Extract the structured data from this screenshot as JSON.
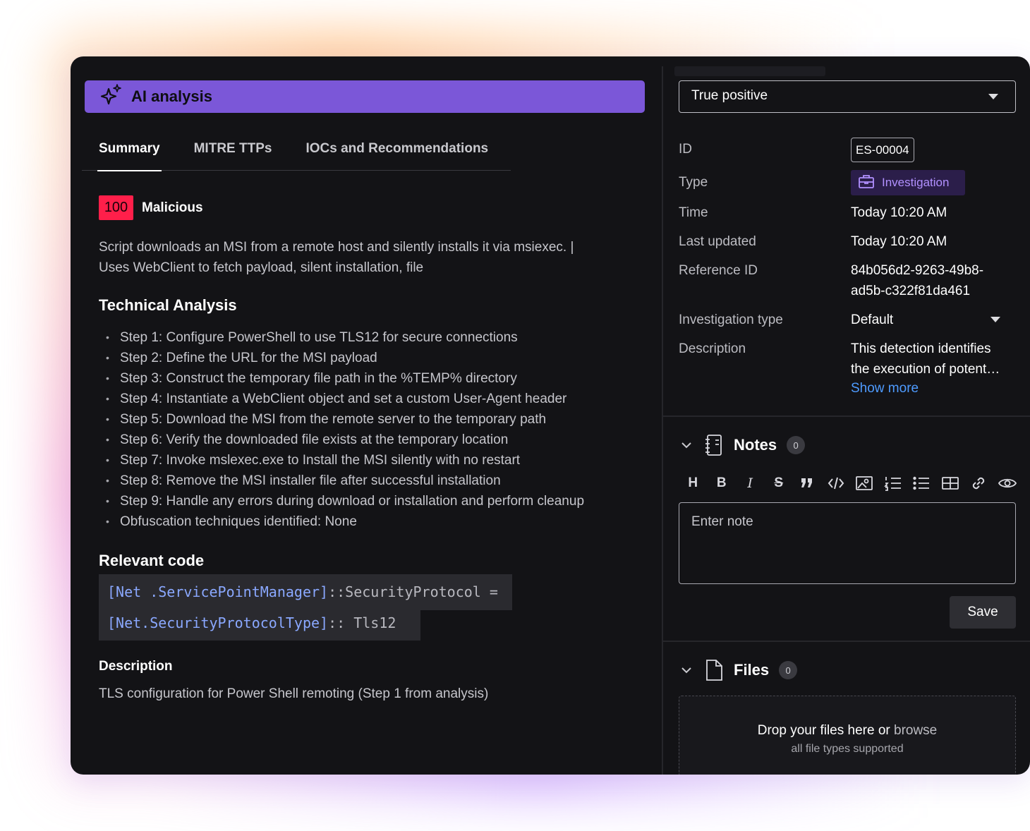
{
  "ai_banner": {
    "title": "AI analysis",
    "icon": "sparkle-icon"
  },
  "tabs": [
    {
      "label": "Summary",
      "active": true
    },
    {
      "label": "MITRE TTPs",
      "active": false
    },
    {
      "label": "IOCs and Recommendations",
      "active": false
    }
  ],
  "score": {
    "value": "100",
    "verdict": "Malicious",
    "color": "#ff1f4a"
  },
  "summary_lines": [
    "Script downloads an MSI from a remote host and silently installs it via msiexec. |",
    "Uses WebClient to fetch payload, silent installation, file"
  ],
  "technical_analysis": {
    "heading": "Technical Analysis",
    "steps": [
      "Step 1: Configure PowerShell to use TLS12 for secure connections",
      "Step 2: Define the URL for the MSI payload",
      "Step 3: Construct the temporary file path in the %TEMP% directory",
      "Step 4: Instantiate a WebClient object and set a custom User-Agent header",
      "Step 5: Download the MSI from the remote server to the temporary path",
      "Step 6: Verify the downloaded file exists at the temporary location",
      "Step 7: Invoke mslexec.exe to Install the MSI silently with no restart",
      "Step 8: Remove the MSI installer file after successful installation",
      "Step 9: Handle any errors during download or installation and perform cleanup",
      "Obfuscation techniques identified: None"
    ]
  },
  "relevant_code": {
    "heading": "Relevant code",
    "line1_type": "[Net .ServicePointManager]",
    "line1_rest": "::SecurityProtocol =",
    "line2_type": "[Net.SecurityProtocolType]",
    "line2_rest": ":: Tls12"
  },
  "description": {
    "heading": "Description",
    "text": "TLS configuration for Power Shell remoting (Step 1 from analysis)"
  },
  "verdict_select": {
    "value": "True positive"
  },
  "meta": {
    "id_label": "ID",
    "id_value": "ES-00004",
    "type_label": "Type",
    "type_value": "Investigation",
    "type_icon": "briefcase-icon",
    "time_label": "Time",
    "time_value": "Today 10:20 AM",
    "updated_label": "Last updated",
    "updated_value": "Today 10:20 AM",
    "ref_label": "Reference ID",
    "ref_value_1": "84b056d2-9263-49b8-",
    "ref_value_2": "ad5b-c322f81da461",
    "invtype_label": "Investigation type",
    "invtype_value": "Default",
    "desc_label": "Description",
    "desc_value_1": "This detection identifies",
    "desc_value_2": "the execution of potent…",
    "show_more": "Show more"
  },
  "notes": {
    "title": "Notes",
    "count": "0",
    "toolbar": [
      "H",
      "B",
      "I",
      "S",
      "quote-icon",
      "code-icon",
      "image-icon",
      "ordered-list-icon",
      "bullet-list-icon",
      "table-icon",
      "link-icon",
      "preview-eye-icon"
    ],
    "placeholder": "Enter note",
    "save_label": "Save"
  },
  "files": {
    "title": "Files",
    "count": "0",
    "drop_text": "Drop your files here or",
    "browse_label": "browse",
    "sub_text": "all file types supported"
  }
}
